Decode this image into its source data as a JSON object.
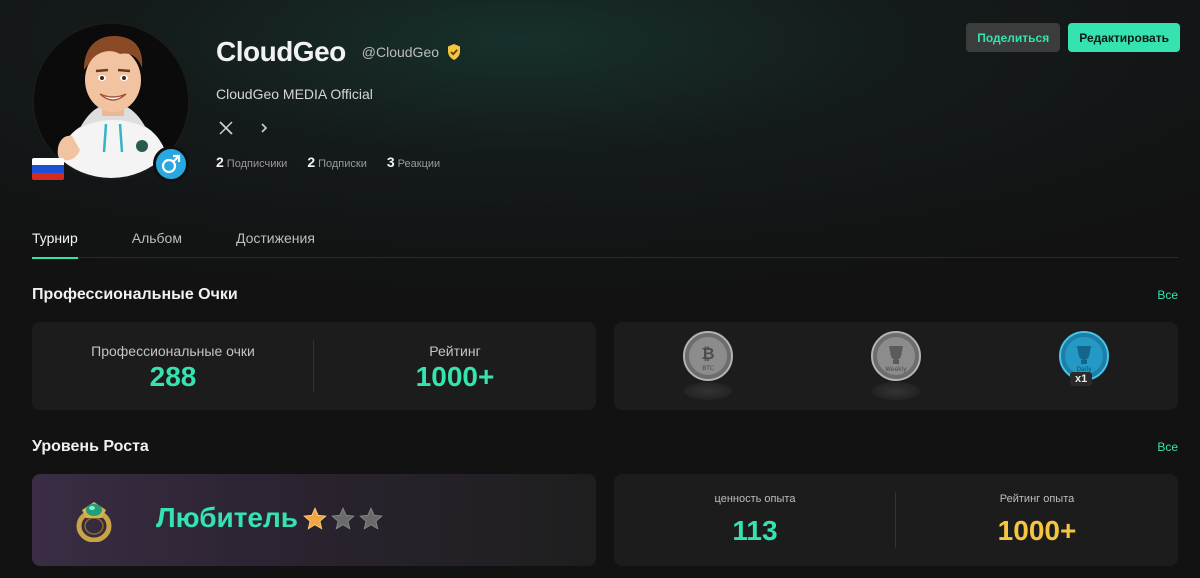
{
  "profile": {
    "name": "CloudGeo",
    "handle": "@CloudGeo",
    "bio": "CloudGeo MEDIA Official",
    "country_flag": "russia-flag",
    "gender_icon": "male-icon",
    "stats": [
      {
        "value": "2",
        "label": "Подписчики"
      },
      {
        "value": "2",
        "label": "Подписки"
      },
      {
        "value": "3",
        "label": "Реакции"
      }
    ]
  },
  "actions": {
    "share_label": "Поделиться",
    "edit_label": "Редактировать"
  },
  "tabs": [
    {
      "label": "Турнир",
      "active": true
    },
    {
      "label": "Альбом",
      "active": false
    },
    {
      "label": "Достижения",
      "active": false
    }
  ],
  "pro_points": {
    "title": "Профессиональные Очки",
    "see_all": "Все",
    "points_label": "Профессиональные очки",
    "points_value": "288",
    "rating_label": "Рейтинг",
    "rating_value": "1000+",
    "badges": [
      {
        "name": "bitcoin-badge",
        "caption": "BTC"
      },
      {
        "name": "weekly-badge",
        "caption": "Weekly"
      },
      {
        "name": "daily-badge",
        "caption": "Daily",
        "count": "x1"
      }
    ]
  },
  "growth": {
    "title": "Уровень Роста",
    "see_all": "Все",
    "level_name": "Любитель",
    "stars_filled": 1,
    "stars_total": 3,
    "exp_label": "ценность опыта",
    "exp_value": "113",
    "exp_rating_label": "Рейтинг опыта",
    "exp_rating_value": "1000+"
  },
  "colors": {
    "accent": "#34e3b0",
    "gold": "#f5c542",
    "gender_blue": "#29a8e0"
  }
}
